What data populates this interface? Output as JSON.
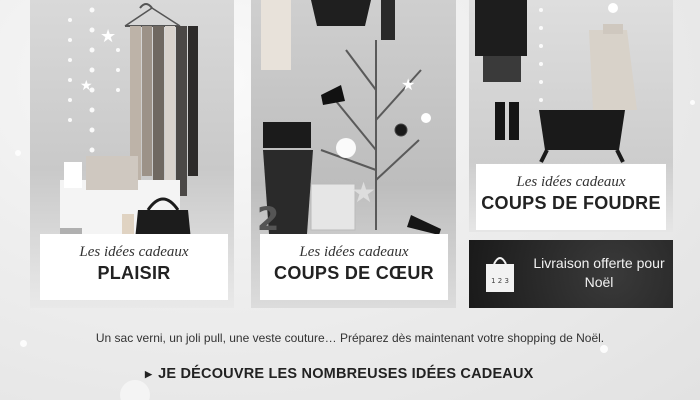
{
  "panels": [
    {
      "subtitle": "Les idées cadeaux",
      "title": "PLAISIR"
    },
    {
      "subtitle": "Les idées cadeaux",
      "title": "COUPS DE CŒUR"
    },
    {
      "subtitle": "Les idées cadeaux",
      "title": "COUPS DE FOUDRE"
    }
  ],
  "shipping": {
    "text": "Livraison offerte pour Noël",
    "bag_label": "1 2 3"
  },
  "description": "Un sac verni, un joli pull, une veste couture… Préparez dès maintenant votre shopping de Noël.",
  "cta": {
    "label": "JE DÉCOUVRE LES NOMBREUSES IDÉES CADEAUX",
    "icon": "triangle-right-icon"
  }
}
